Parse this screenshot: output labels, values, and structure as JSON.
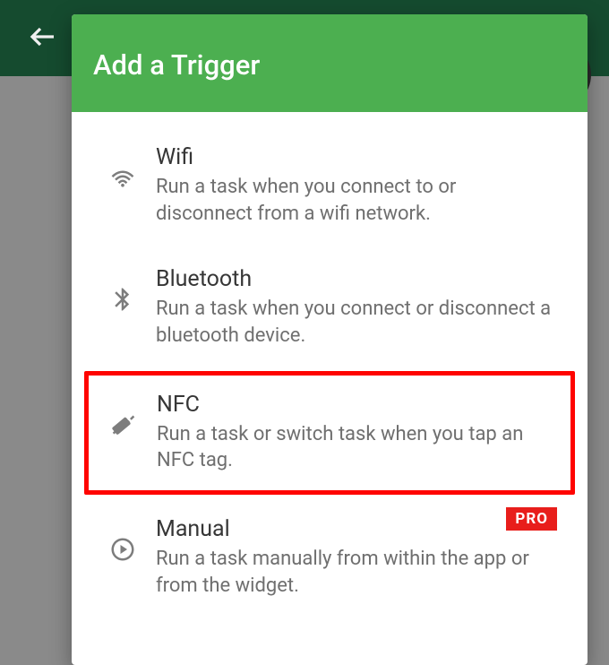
{
  "dialog": {
    "title": "Add a Trigger"
  },
  "triggers": [
    {
      "title": "Wifi",
      "desc": "Run a task when you connect to or disconnect from a wifi network.",
      "icon": "wifi-icon",
      "highlighted": false,
      "pro": false
    },
    {
      "title": "Bluetooth",
      "desc": "Run a task when you connect or disconnect a bluetooth device.",
      "icon": "bluetooth-icon",
      "highlighted": false,
      "pro": false
    },
    {
      "title": "NFC",
      "desc": "Run a task or switch task when you tap an NFC tag.",
      "icon": "nfc-icon",
      "highlighted": true,
      "pro": false
    },
    {
      "title": "Manual",
      "desc": "Run a task manually from within the app or from the widget.",
      "icon": "play-icon",
      "highlighted": false,
      "pro": true
    }
  ],
  "badge": {
    "pro": "PRO"
  }
}
